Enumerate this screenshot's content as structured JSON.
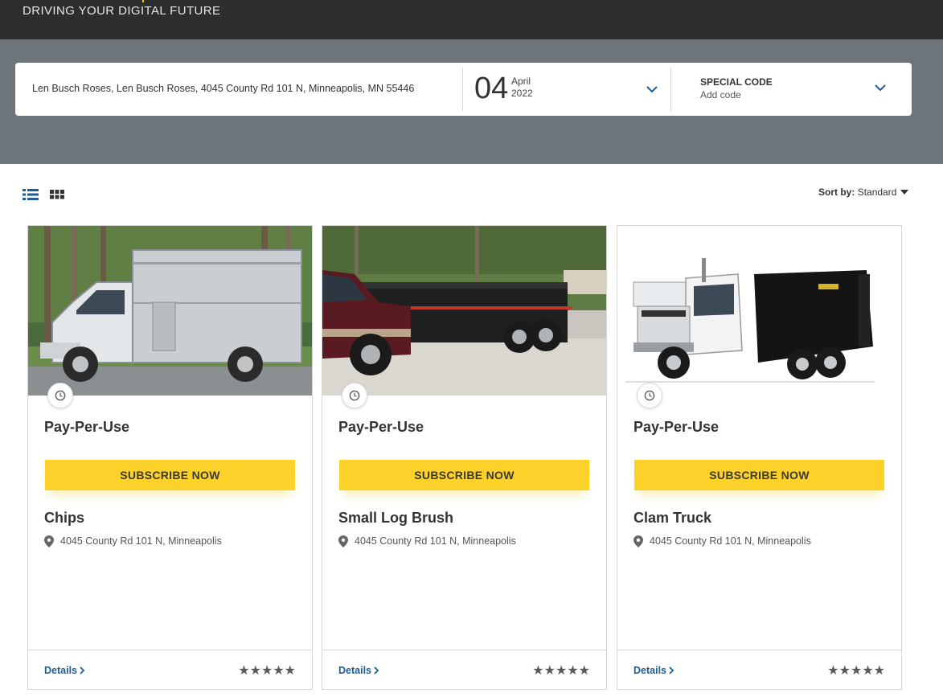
{
  "header": {
    "tagline": "DRIVING YOUR DIGITAL FUTURE",
    "accent_color": "#f5c518"
  },
  "search": {
    "address": "Len Busch Roses, Len Busch Roses, 4045 County Rd 101 N, Minneapolis, MN 55446",
    "date_day": "04",
    "date_month": "April",
    "date_year": "2022",
    "code_title": "SPECIAL CODE",
    "code_placeholder": "Add code",
    "chevron_icon": "chevron-down-icon"
  },
  "toolbar": {
    "list_view_icon": "list-view-icon",
    "grid_view_icon": "grid-view-icon",
    "sort_label": "Sort by:",
    "sort_value": "Standard",
    "active_color": "#1f5c94"
  },
  "cards": [
    {
      "plan": "Pay-Per-Use",
      "subscribe_label": "SUBSCRIBE NOW",
      "name": "Chips",
      "location": "4045 County Rd 101 N, Minneapolis",
      "details_label": "Details",
      "stars": "★★★★★",
      "image": "white chip truck"
    },
    {
      "plan": "Pay-Per-Use",
      "subscribe_label": "SUBSCRIBE NOW",
      "name": "Small Log Brush",
      "location": "4045 County Rd 101 N, Minneapolis",
      "details_label": "Details",
      "stars": "★★★★★",
      "image": "pickup towing dump trailer"
    },
    {
      "plan": "Pay-Per-Use",
      "subscribe_label": "SUBSCRIBE NOW",
      "name": "Clam Truck",
      "location": "4045 County Rd 101 N, Minneapolis",
      "details_label": "Details",
      "stars": "★★★★★",
      "image": "roll-off container truck"
    }
  ],
  "colors": {
    "subscribe_button": "#fcd22a",
    "link": "#1f5c94",
    "hero_background": "#6d747a",
    "topbar_background": "#2b2d2f"
  }
}
